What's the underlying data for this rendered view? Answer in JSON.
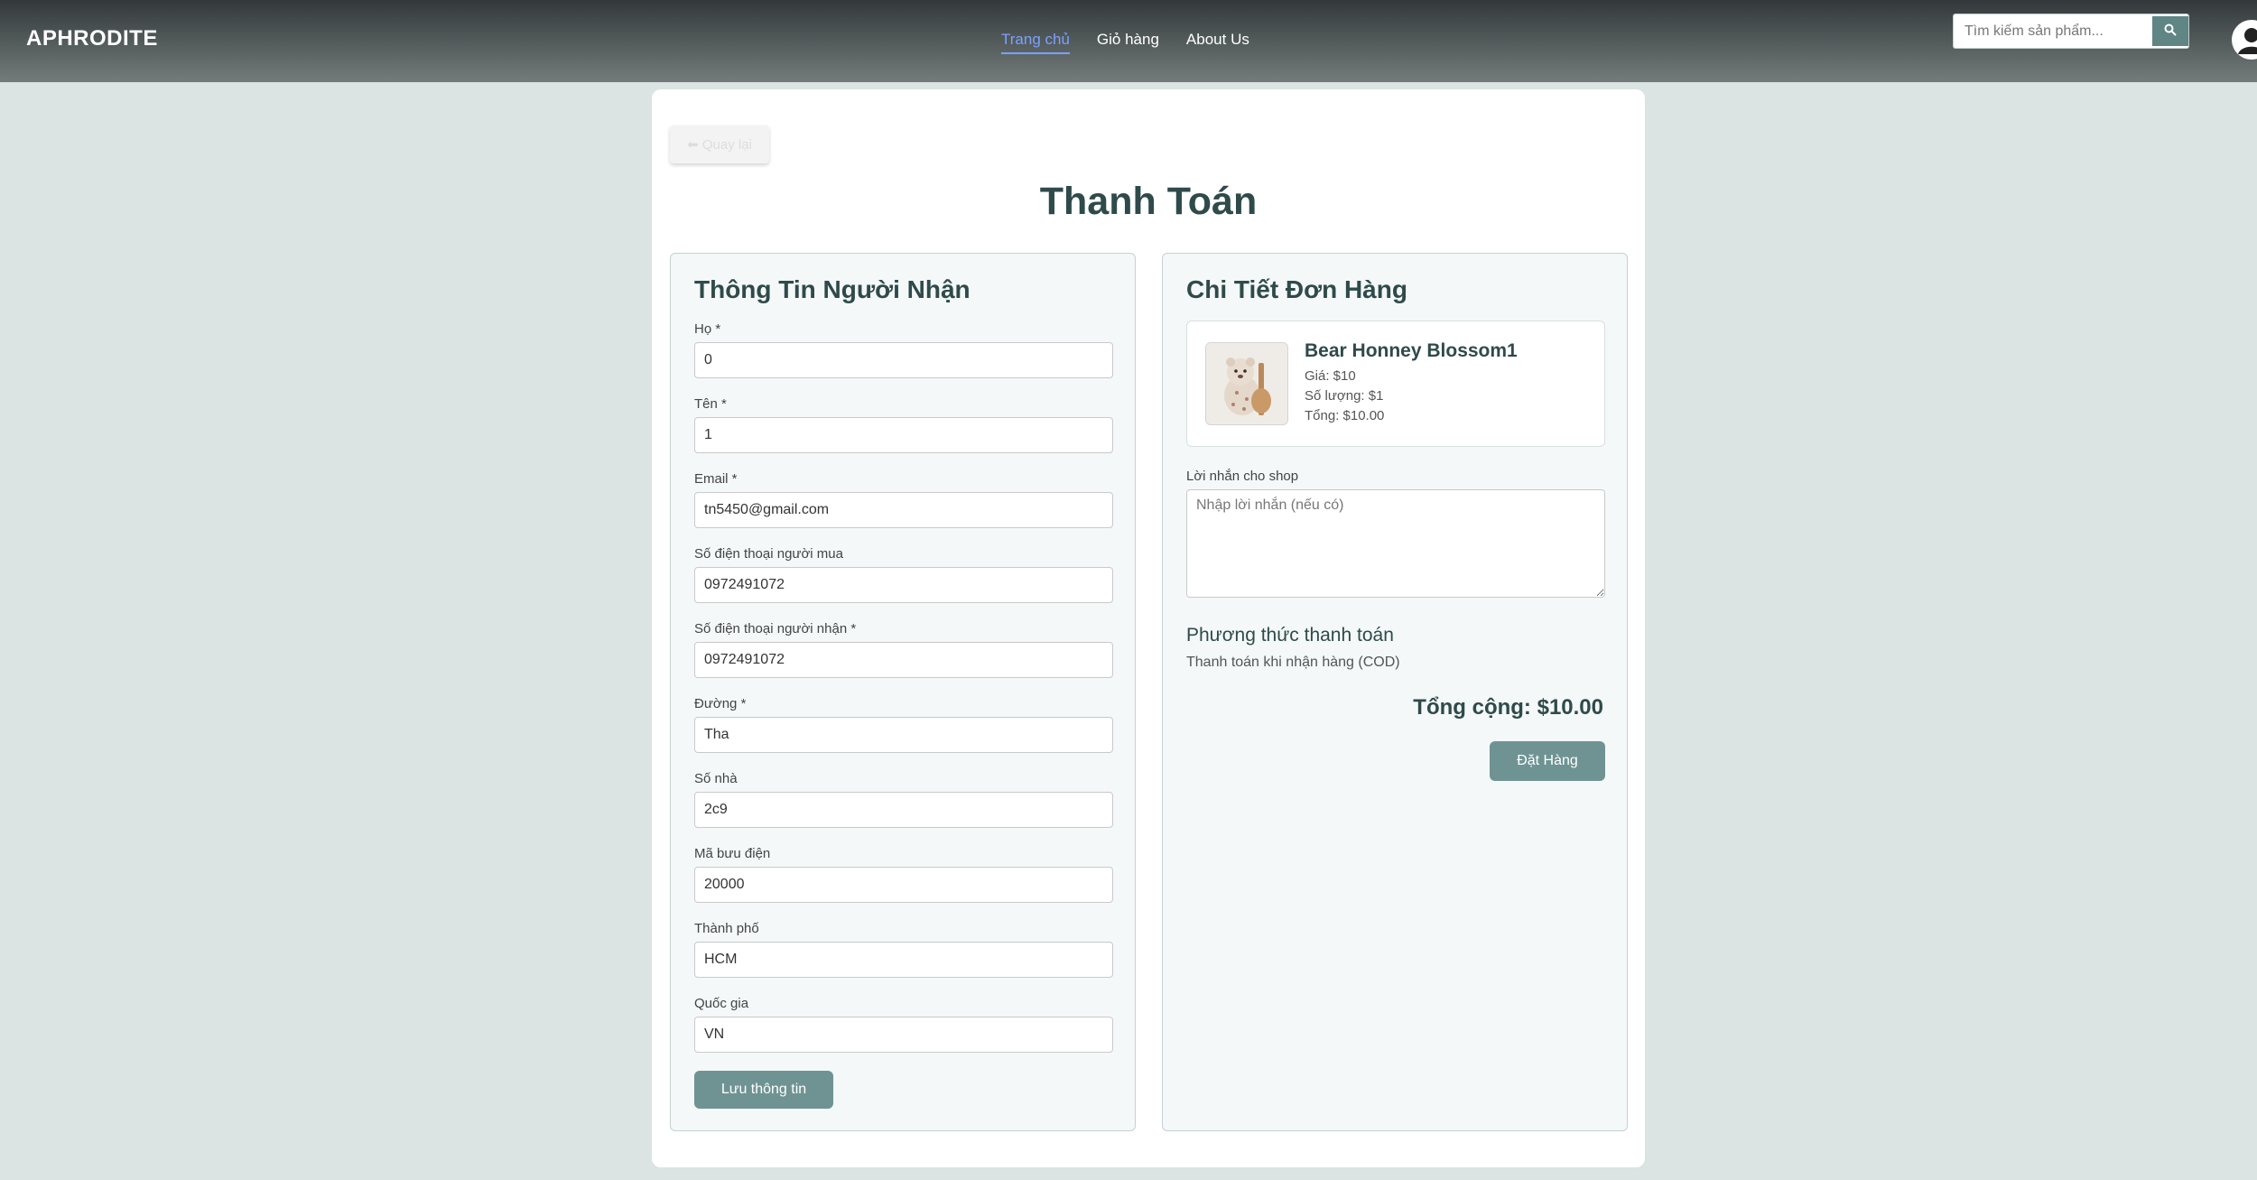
{
  "navbar": {
    "brand": "APHRODITE",
    "links": [
      "Trang chủ",
      "Giỏ hàng",
      "About Us"
    ],
    "search_placeholder": "Tìm kiếm sản phẩm...",
    "search_icon": "search-icon",
    "avatar_icon": "user-avatar-icon"
  },
  "page": {
    "back_label": "⬅ Quay lại",
    "title": "Thanh Toán"
  },
  "recipient": {
    "title": "Thông Tin Người Nhận",
    "fields": [
      {
        "label": "Họ *",
        "value": "0"
      },
      {
        "label": "Tên *",
        "value": "1"
      },
      {
        "label": "Email *",
        "value": "tn5450@gmail.com"
      },
      {
        "label": "Số điện thoại người mua",
        "value": "0972491072"
      },
      {
        "label": "Số điện thoại người nhận *",
        "value": "0972491072"
      },
      {
        "label": "Đường *",
        "value": "Tha"
      },
      {
        "label": "Số nhà",
        "value": "2c9"
      },
      {
        "label": "Mã bưu điện",
        "value": "20000"
      },
      {
        "label": "Thành phố",
        "value": "HCM"
      },
      {
        "label": "Quốc gia",
        "value": "VN"
      }
    ],
    "save_label": "Lưu thông tin"
  },
  "order": {
    "title": "Chi Tiết Đơn Hàng",
    "item": {
      "name": "Bear Honney Blossom1",
      "price": "Giá: $10",
      "quantity": "Số lượng: $1",
      "total": "Tổng: $10.00"
    },
    "note_label": "Lời nhắn cho shop",
    "note_placeholder": "Nhập lời nhắn (nếu có)",
    "payment_title": "Phương thức thanh toán",
    "payment_method": "Thanh toán khi nhận hàng (COD)",
    "grand_total": "Tổng cộng: $10.00",
    "order_label": "Đặt Hàng"
  },
  "colors": {
    "accent": "#6f9393",
    "nav_active": "#7aa2ff",
    "background": "#dbe3e3"
  }
}
